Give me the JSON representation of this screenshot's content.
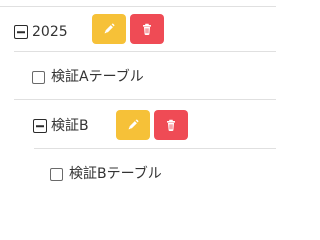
{
  "tree": {
    "nodes": [
      {
        "id": "year-2025",
        "label": "2025",
        "expanded": true,
        "actions": [
          "edit",
          "delete"
        ],
        "children": [
          {
            "id": "table-a",
            "label": "検証Aテーブル",
            "checked": false
          },
          {
            "id": "folder-b",
            "label": "検証B",
            "expanded": true,
            "actions": [
              "edit",
              "delete"
            ],
            "children": [
              {
                "id": "table-b",
                "label": "検証Bテーブル",
                "checked": false
              }
            ]
          }
        ]
      }
    ]
  },
  "colors": {
    "edit_button": "#F6C138",
    "delete_button": "#EF4B55",
    "text": "#333333",
    "divider": "#E0E0E0"
  },
  "icons": {
    "expand_collapse": "minus-square-icon",
    "edit": "pencil-icon",
    "delete": "trash-icon"
  }
}
